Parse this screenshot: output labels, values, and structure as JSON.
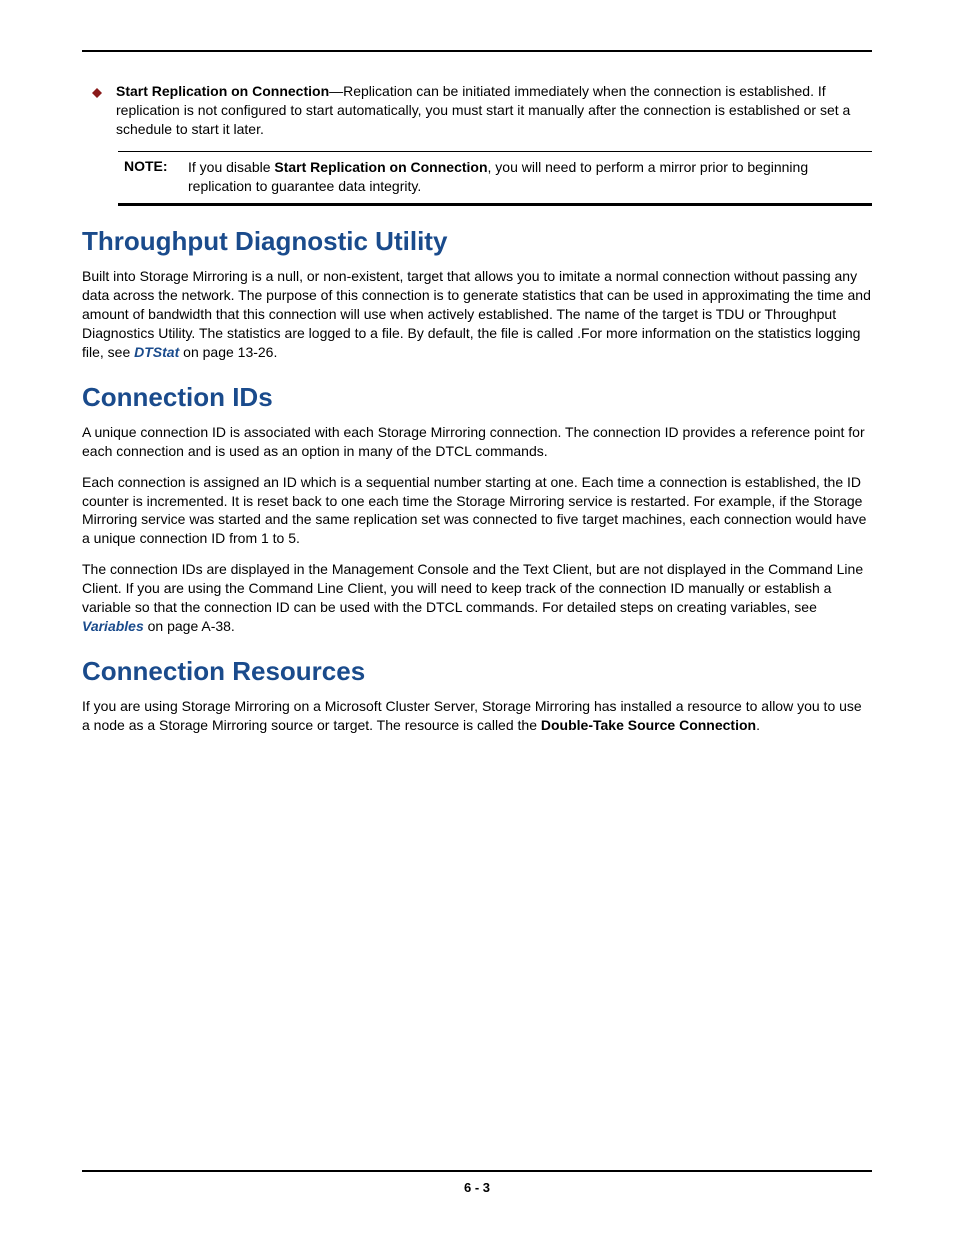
{
  "bullet": {
    "bold": "Start Replication on Connection",
    "text": "—Replication can be initiated immediately when the connection is established. If replication is not configured to start automatically, you must start it manually after the connection is established or set a schedule to start it later."
  },
  "note": {
    "label": "NOTE:",
    "pre": "If you disable ",
    "bold": "Start Replication on Connection",
    "post": ", you will need to perform a mirror prior to beginning replication to guarantee data integrity."
  },
  "tdu": {
    "heading": "Throughput Diagnostic Utility",
    "p1_pre": "Built into Storage Mirroring is a null, or non-existent, target that allows you to imitate a normal connection without passing any data across the network. The purpose of this connection is to generate statistics that can be used in approximating the time and amount of bandwidth that this connection will use when actively established. The name of the target is TDU or Throughput Diagnostics Utility. The statistics are logged to a file. By default, the file is called ",
    "p1_mid": ".For more information on the statistics logging file, see ",
    "p1_link": "DTStat",
    "p1_post": " on page 13-26."
  },
  "cid": {
    "heading": "Connection IDs",
    "p1": "A unique connection ID is associated with each Storage Mirroring connection. The connection ID provides a reference point for each connection and is used as an option in many of the DTCL commands.",
    "p2": "Each connection is assigned an ID which is a sequential number starting at one. Each time a connection is established, the ID counter is incremented. It is reset back to one each time the Storage Mirroring service is restarted. For example, if the Storage Mirroring service was started and the same replication set was connected to five target machines, each connection would have a unique connection ID from 1 to 5.",
    "p3_pre": "The connection IDs are displayed in the Management Console and the Text Client, but are not displayed in the Command Line Client. If you are using the Command Line Client, you will need to keep track of the connection ID manually or establish a variable so that the connection ID can be used with the DTCL commands. For detailed steps on creating variables, see ",
    "p3_link": "Variables",
    "p3_post": " on page A-38."
  },
  "cr": {
    "heading": "Connection Resources",
    "p1_pre": "If you are using Storage Mirroring on a Microsoft Cluster Server, Storage Mirroring has installed a resource to allow you to use a node as a Storage Mirroring source or target. The resource is called the ",
    "p1_bold": "Double-Take Source Connection",
    "p1_post": "."
  },
  "footer": "6 - 3"
}
